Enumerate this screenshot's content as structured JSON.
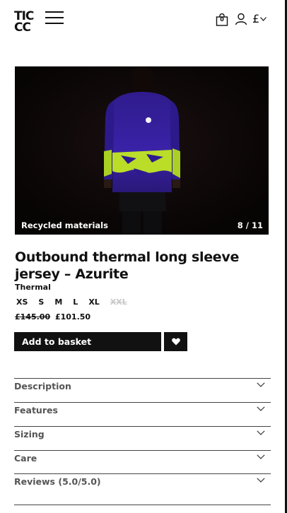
{
  "header": {
    "logo_line1": "TIC",
    "logo_line2": "CC",
    "menu_icon": "hamburger-menu-icon",
    "basket_icon": "shopping-bag-icon",
    "basket_count": "0",
    "account_icon": "user-icon",
    "currency_symbol": "£",
    "currency_chevron_icon": "chevron-down-icon"
  },
  "gallery": {
    "caption": "Recycled materials",
    "counter": "8 / 11"
  },
  "product": {
    "title": "Outbound thermal long sleeve jersey – Azurite",
    "subtitle": "Thermal",
    "sizes": [
      {
        "label": "XS",
        "available": true
      },
      {
        "label": "S",
        "available": true
      },
      {
        "label": "M",
        "available": true
      },
      {
        "label": "L",
        "available": true
      },
      {
        "label": "XL",
        "available": true
      },
      {
        "label": "XXL",
        "available": false
      }
    ],
    "price_old": "£145.00",
    "price_new": "£101.50",
    "add_to_basket": "Add to basket",
    "wishlist_icon": "heart-icon"
  },
  "accordion": [
    {
      "label": "Description"
    },
    {
      "label": "Features"
    },
    {
      "label": "Sizing"
    },
    {
      "label": "Care"
    },
    {
      "label": "Reviews (5.0/5.0)"
    }
  ],
  "colors": {
    "text": "#111111",
    "muted": "#555555",
    "button_bg": "#111111",
    "photo_bg": "#0b0606",
    "jersey": "#3a1f9e",
    "jersey_print": "#c8f020"
  }
}
